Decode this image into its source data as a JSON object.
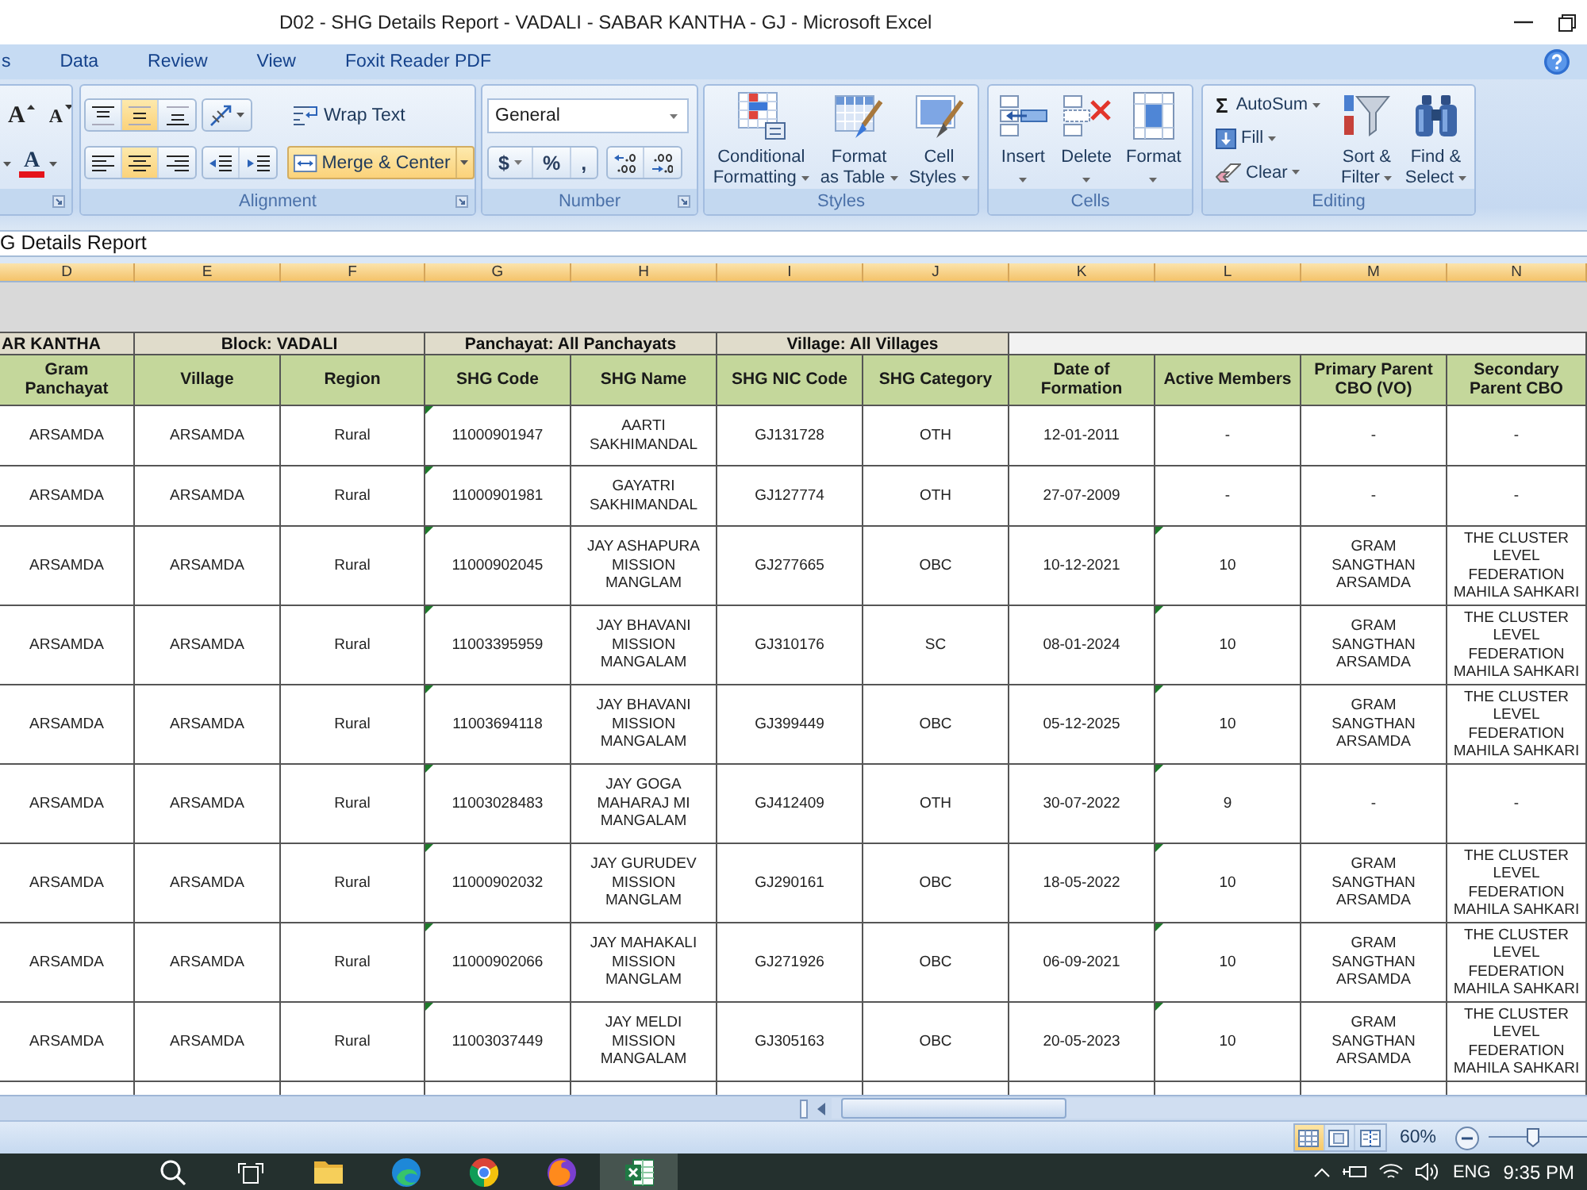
{
  "window": {
    "title": "D02 - SHG Details Report - VADALI - SABAR KANTHA - GJ - Microsoft Excel"
  },
  "ribbon": {
    "tabs": [
      {
        "label": "s",
        "selected": false
      },
      {
        "label": "Data",
        "selected": false
      },
      {
        "label": "Review",
        "selected": false
      },
      {
        "label": "View",
        "selected": false
      },
      {
        "label": "Foxit Reader PDF",
        "selected": false
      }
    ],
    "font": {
      "buttons": [
        "A",
        "A",
        "A"
      ]
    },
    "alignment": {
      "vertical": [
        {
          "kind": "top",
          "selected": false
        },
        {
          "kind": "middle",
          "selected": true
        },
        {
          "kind": "bottom",
          "selected": false
        }
      ],
      "horizontal": [
        {
          "kind": "left",
          "selected": false
        },
        {
          "kind": "center",
          "selected": true
        },
        {
          "kind": "right",
          "selected": false
        }
      ],
      "wrap_text": {
        "label": "Wrap Text",
        "selected": false
      },
      "merge": {
        "label": "Merge & Center",
        "selected": true
      },
      "label": "Alignment"
    },
    "number": {
      "format": "General",
      "symbols": [
        "$",
        "%",
        ","
      ],
      "label": "Number"
    },
    "styles": {
      "buttons": [
        {
          "kind": "conditional",
          "lines": [
            "Conditional",
            "Formatting"
          ]
        },
        {
          "kind": "table",
          "lines": [
            "Format",
            "as Table"
          ]
        },
        {
          "kind": "cell",
          "lines": [
            "Cell",
            "Styles"
          ]
        }
      ],
      "label": "Styles"
    },
    "cells": {
      "buttons": [
        {
          "kind": "insert",
          "label": "Insert"
        },
        {
          "kind": "delete",
          "label": "Delete"
        },
        {
          "kind": "format",
          "label": "Format"
        }
      ],
      "label": "Cells"
    },
    "editing": {
      "autosum": {
        "symbol": "Σ",
        "label": "AutoSum"
      },
      "fill": "Fill",
      "clear": "Clear",
      "large": [
        {
          "kind": "sort",
          "lines": [
            "Sort &",
            "Filter"
          ]
        },
        {
          "kind": "find",
          "lines": [
            "Find &",
            "Select"
          ]
        }
      ],
      "label": "Editing"
    }
  },
  "formula_bar": {
    "value": "G Details Report"
  },
  "sheet": {
    "columns": [
      {
        "letter": "D",
        "selected": true
      },
      {
        "letter": "E",
        "selected": true
      },
      {
        "letter": "F",
        "selected": true
      },
      {
        "letter": "G",
        "selected": true
      },
      {
        "letter": "H",
        "selected": true
      },
      {
        "letter": "I",
        "selected": true
      },
      {
        "letter": "J",
        "selected": true
      },
      {
        "letter": "K",
        "selected": true
      },
      {
        "letter": "L",
        "selected": true
      },
      {
        "letter": "M",
        "selected": true
      },
      {
        "letter": "N",
        "selected": true
      }
    ],
    "filters": [
      "AR KANTHA",
      "Block: VADALI",
      "Panchayat: All Panchayats",
      "Village: All Villages"
    ],
    "headers": [
      "Gram Panchayat",
      "Village",
      "Region",
      "SHG Code",
      "SHG Name",
      "SHG NIC Code",
      "SHG Category",
      "Date of Formation",
      "Active Members",
      "Primary Parent CBO (VO)",
      "Secondary Parent CBO"
    ],
    "rows": [
      {
        "cells": [
          "ARSAMDA",
          "ARSAMDA",
          "Rural",
          "11000901947",
          "AARTI SAKHIMANDAL",
          "GJ131728",
          "OTH",
          "12-01-2011",
          "-",
          "-",
          "-"
        ],
        "code_flag": true,
        "members_flag": false
      },
      {
        "cells": [
          "ARSAMDA",
          "ARSAMDA",
          "Rural",
          "11000901981",
          "GAYATRI SAKHIMANDAL",
          "GJ127774",
          "OTH",
          "27-07-2009",
          "-",
          "-",
          "-"
        ],
        "code_flag": true,
        "members_flag": false
      },
      {
        "cells": [
          "ARSAMDA",
          "ARSAMDA",
          "Rural",
          "11000902045",
          "JAY ASHAPURA MISSION MANGLAM",
          "GJ277665",
          "OBC",
          "10-12-2021",
          "10",
          "GRAM SANGTHAN ARSAMDA",
          "THE CLUSTER LEVEL FEDERATION MAHILA SAHKARI"
        ],
        "code_flag": true,
        "members_flag": true
      },
      {
        "cells": [
          "ARSAMDA",
          "ARSAMDA",
          "Rural",
          "11003395959",
          "JAY BHAVANI MISSION MANGALAM",
          "GJ310176",
          "SC",
          "08-01-2024",
          "10",
          "GRAM SANGTHAN ARSAMDA",
          "THE CLUSTER LEVEL FEDERATION MAHILA SAHKARI"
        ],
        "code_flag": true,
        "members_flag": true
      },
      {
        "cells": [
          "ARSAMDA",
          "ARSAMDA",
          "Rural",
          "11003694118",
          "JAY BHAVANI MISSION MANGALAM",
          "GJ399449",
          "OBC",
          "05-12-2025",
          "10",
          "GRAM SANGTHAN ARSAMDA",
          "THE CLUSTER LEVEL FEDERATION MAHILA SAHKARI"
        ],
        "code_flag": true,
        "members_flag": true
      },
      {
        "cells": [
          "ARSAMDA",
          "ARSAMDA",
          "Rural",
          "11003028483",
          "JAY GOGA MAHARAJ MI MANGALAM",
          "GJ412409",
          "OTH",
          "30-07-2022",
          "9",
          "-",
          "-"
        ],
        "code_flag": true,
        "members_flag": true
      },
      {
        "cells": [
          "ARSAMDA",
          "ARSAMDA",
          "Rural",
          "11000902032",
          "JAY GURUDEV MISSION MANGLAM",
          "GJ290161",
          "OBC",
          "18-05-2022",
          "10",
          "GRAM SANGTHAN ARSAMDA",
          "THE CLUSTER LEVEL FEDERATION MAHILA SAHKARI"
        ],
        "code_flag": true,
        "members_flag": true
      },
      {
        "cells": [
          "ARSAMDA",
          "ARSAMDA",
          "Rural",
          "11000902066",
          "JAY MAHAKALI MISSION MANGLAM",
          "GJ271926",
          "OBC",
          "06-09-2021",
          "10",
          "GRAM SANGTHAN ARSAMDA",
          "THE CLUSTER LEVEL FEDERATION MAHILA SAHKARI"
        ],
        "code_flag": true,
        "members_flag": true
      },
      {
        "cells": [
          "ARSAMDA",
          "ARSAMDA",
          "Rural",
          "11003037449",
          "JAY MELDI MISSION MANGALAM",
          "GJ305163",
          "OBC",
          "20-05-2023",
          "10",
          "GRAM SANGTHAN ARSAMDA",
          "THE CLUSTER LEVEL FEDERATION MAHILA SAHKARI"
        ],
        "code_flag": true,
        "members_flag": true
      }
    ]
  },
  "status_bar": {
    "views": [
      {
        "kind": "normal",
        "selected": true
      },
      {
        "kind": "page_layout",
        "selected": false
      },
      {
        "kind": "page_break",
        "selected": false
      }
    ],
    "zoom": "60%",
    "zoom_slider": {
      "level": 0.45
    }
  },
  "taskbar": {
    "apps": [
      {
        "kind": "search",
        "active": false
      },
      {
        "kind": "task_view",
        "active": false
      },
      {
        "kind": "folder",
        "active": false
      },
      {
        "kind": "wave",
        "active": false
      },
      {
        "kind": "ring",
        "active": false
      },
      {
        "kind": "fox",
        "active": false
      },
      {
        "kind": "spreadsheet",
        "active": true
      }
    ],
    "language": "ENG",
    "time": "9:35 PM"
  }
}
